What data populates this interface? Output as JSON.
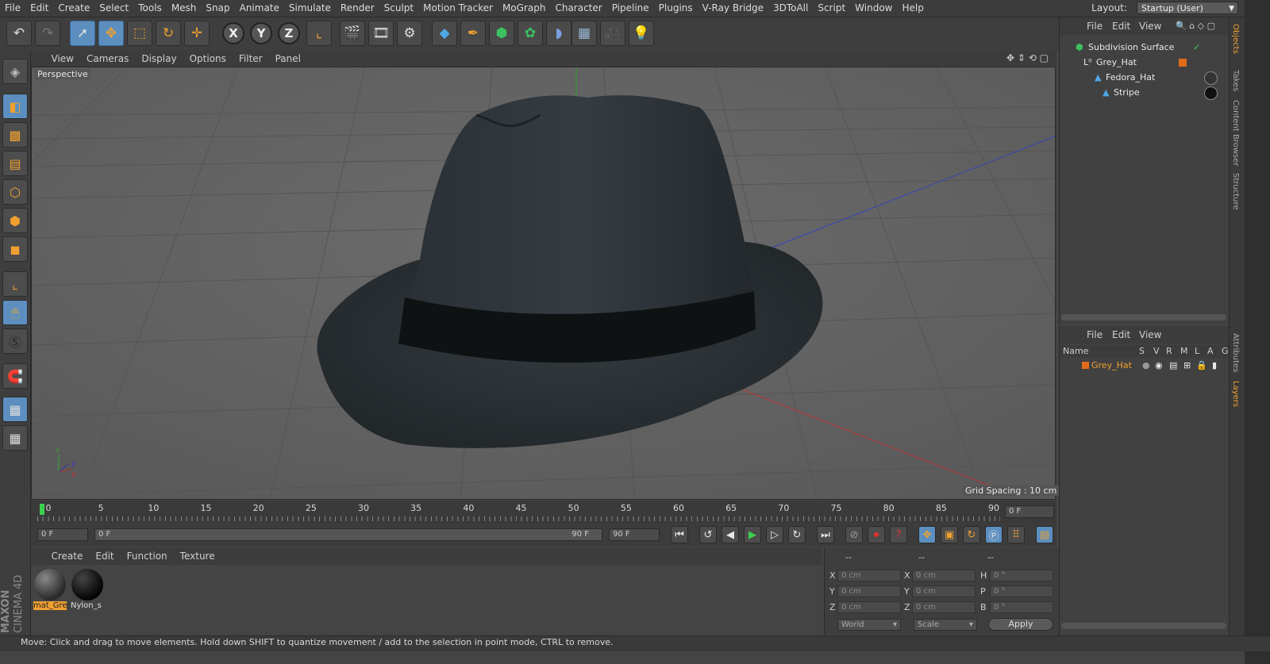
{
  "menubar": {
    "items": [
      "File",
      "Edit",
      "Create",
      "Select",
      "Tools",
      "Mesh",
      "Snap",
      "Animate",
      "Simulate",
      "Render",
      "Sculpt",
      "Motion Tracker",
      "MoGraph",
      "Character",
      "Pipeline",
      "Plugins",
      "V-Ray Bridge",
      "3DToAll",
      "Script",
      "Window",
      "Help"
    ],
    "layout_label": "Layout:",
    "layout_value": "Startup (User)"
  },
  "toolbar": {
    "icons": [
      "undo-icon",
      "redo-icon",
      "select-pointer-icon",
      "move-icon",
      "scale-icon",
      "rotate-icon",
      "live-select-icon",
      "x-axis-lock-icon",
      "y-axis-lock-icon",
      "z-axis-lock-icon",
      "coordinate-system-icon",
      "render-view-icon",
      "render-picture-viewer-icon",
      "render-settings-icon",
      "cube-primitive-icon",
      "pen-spline-icon",
      "subdivision-icon",
      "cloner-icon",
      "deformer-icon",
      "floor-icon",
      "camera-icon",
      "light-icon"
    ],
    "axis_x": "X",
    "axis_y": "Y",
    "axis_z": "Z"
  },
  "viewport": {
    "menu": [
      "View",
      "Cameras",
      "Display",
      "Options",
      "Filter",
      "Panel"
    ],
    "label": "Perspective",
    "grid_spacing": "Grid Spacing : 10 cm"
  },
  "timeline": {
    "ticks": [
      "0",
      "5",
      "10",
      "15",
      "20",
      "25",
      "30",
      "35",
      "40",
      "45",
      "50",
      "55",
      "60",
      "65",
      "70",
      "75",
      "80",
      "85",
      "90"
    ],
    "current_frame_field": "0 F",
    "start_field": "0 F",
    "range_start": "0 F",
    "range_end": "90 F",
    "end_field": "90 F",
    "current_frame_right": "0 F"
  },
  "materials": {
    "menu": [
      "Create",
      "Edit",
      "Function",
      "Texture"
    ],
    "items": [
      {
        "name": "mat_Gre",
        "selected": true
      },
      {
        "name": "Nylon_s",
        "selected": false
      }
    ]
  },
  "coordinates": {
    "header_a": "--",
    "header_b": "--",
    "header_c": "--",
    "pos": {
      "x_label": "X",
      "x": "0 cm",
      "y_label": "Y",
      "y": "0 cm",
      "z_label": "Z",
      "z": "0 cm"
    },
    "size": {
      "x_label": "X",
      "x": "0 cm",
      "y_label": "Y",
      "y": "0 cm",
      "z_label": "Z",
      "z": "0 cm"
    },
    "rot": {
      "h_label": "H",
      "h": "0 °",
      "p_label": "P",
      "p": "0 °",
      "b_label": "B",
      "b": "0 °"
    },
    "space": "World",
    "mode": "Scale",
    "apply": "Apply"
  },
  "object_manager": {
    "menu": [
      "File",
      "Edit",
      "View"
    ],
    "objects": [
      {
        "name": "Subdivision Surface"
      },
      {
        "name": "Grey_Hat"
      },
      {
        "name": "Fedora_Hat"
      },
      {
        "name": "Stripe"
      }
    ]
  },
  "layers_manager": {
    "menu": [
      "File",
      "Edit",
      "View"
    ],
    "columns": [
      "Name",
      "S",
      "V",
      "R",
      "M",
      "L",
      "A",
      "G"
    ],
    "layers": [
      {
        "name": "Grey_Hat",
        "color": "#e06a1c"
      }
    ]
  },
  "side_tabs": [
    "Objects",
    "Takes",
    "Content Browser",
    "Structure",
    "Attributes",
    "Layers"
  ],
  "logo": {
    "line1": "MAXON",
    "line2": "CINEMA 4D"
  },
  "status": "Move: Click and drag to move elements. Hold down SHIFT to quantize movement / add to the selection in point mode, CTRL to remove.",
  "colors": {
    "accent": "#f0a030",
    "selection": "#5c8fbf",
    "layer_orange": "#e06a1c"
  }
}
